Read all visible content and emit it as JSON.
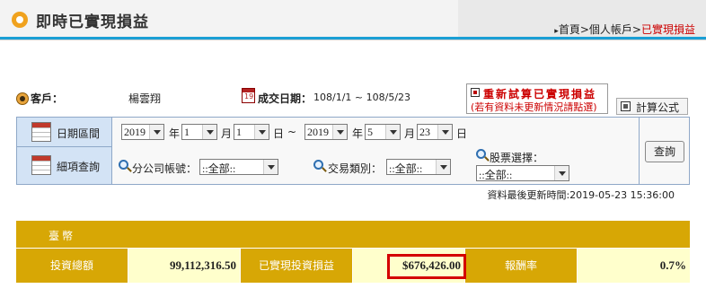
{
  "header": {
    "title": "即時已實現損益",
    "breadcrumb": [
      "首頁",
      "個人帳戶",
      "已實現損益"
    ],
    "separator": ">"
  },
  "info": {
    "customer_label": "客戶：",
    "customer_name": "楊雲翔",
    "calendar_glyph": "19",
    "trade_date_label": "成交日期：",
    "trade_date_range": "108/1/1 ~ 108/5/23"
  },
  "recalc": {
    "line1": "重新試算已實現損益",
    "line2": "(若有資料未更新情況請點選)"
  },
  "formula_button": "計算公式",
  "search": {
    "date_range_label": "日期區間",
    "detail_label": "細項查詢",
    "start_year": "2019",
    "start_month": "1",
    "start_day": "1",
    "end_year": "2019",
    "end_month": "5",
    "end_day": "23",
    "year_unit": "年",
    "month_unit": "月",
    "day_unit": "日",
    "tilde": "~",
    "branch_label": "分公司帳號：",
    "branch_value": "::全部::",
    "trade_type_label": "交易類別：",
    "trade_type_value": "::全部::",
    "stock_select_label": "股票選擇：",
    "stock_select_value": "::全部::",
    "query_button": "查詢"
  },
  "last_updated": "資料最後更新時間:2019-05-23 15:36:00",
  "summary": {
    "currency_header": "臺幣",
    "total_investment_label": "投資總額",
    "total_investment_value": "99,112,316.50",
    "realized_pnl_label": "已實現投資損益",
    "realized_pnl_value": "$676,426.00",
    "return_rate_label": "報酬率",
    "return_rate_value": "0.7%"
  },
  "colors": {
    "accent_blue": "#1a9fd5",
    "gold": "#d7a705",
    "highlight_red": "#d40000"
  }
}
